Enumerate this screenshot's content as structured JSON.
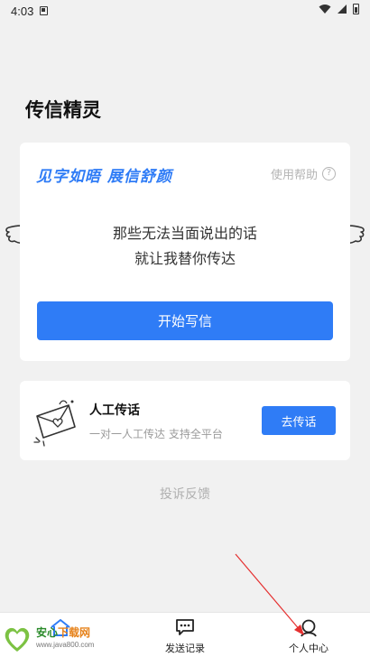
{
  "status_bar": {
    "time": "4:03"
  },
  "app_title": "传信精灵",
  "main_card": {
    "slogan": "见字如晤 展信舒颜",
    "help_label": "使用帮助",
    "help_icon_glyph": "?",
    "message_line1": "那些无法当面说出的话",
    "message_line2": "就让我替你传达",
    "start_button_label": "开始写信"
  },
  "relay_card": {
    "title": "人工传话",
    "description": "一对一人工传达 支持全平台",
    "button_label": "去传话"
  },
  "feedback_label": "投诉反馈",
  "bottom_nav": {
    "items": [
      {
        "label": "",
        "icon": "home-icon"
      },
      {
        "label": "发送记录",
        "icon": "chat-bubble-icon"
      },
      {
        "label": "个人中心",
        "icon": "person-icon"
      }
    ]
  },
  "watermark": {
    "brand_part1": "安心",
    "brand_part2": "下载网",
    "url": "www.java800.com"
  },
  "colors": {
    "accent": "#2f7cf6",
    "background": "#f1f1f1",
    "card": "#ffffff",
    "annotation_arrow": "#e53030"
  }
}
